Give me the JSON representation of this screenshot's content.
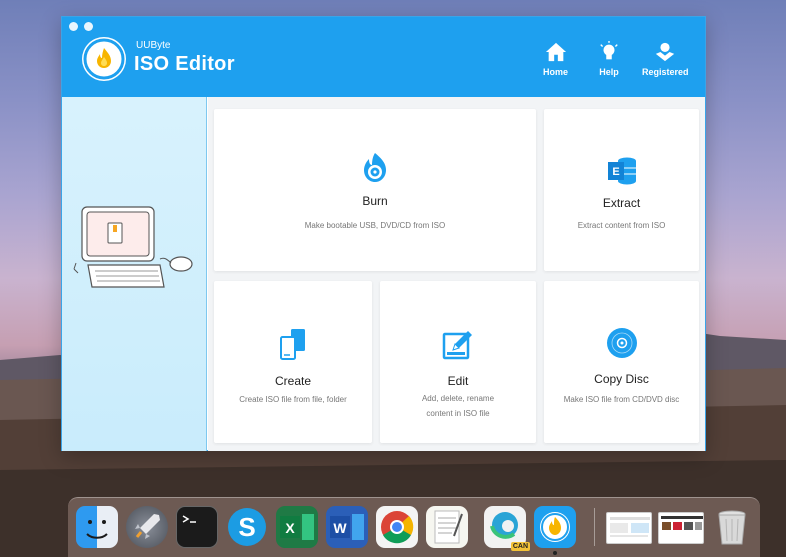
{
  "app": {
    "brand_small": "UUByte",
    "brand_name": "ISO Editor"
  },
  "nav": {
    "home": "Home",
    "help": "Help",
    "registered": "Registered"
  },
  "cards": {
    "burn": {
      "title": "Burn",
      "desc": "Make bootable USB, DVD/CD from ISO"
    },
    "extract": {
      "title": "Extract",
      "desc": "Extract content from ISO"
    },
    "create": {
      "title": "Create",
      "desc": "Create ISO file from file, folder"
    },
    "edit": {
      "title": "Edit",
      "desc": "Add, delete, rename content in ISO file"
    },
    "copy": {
      "title": "Copy Disc",
      "desc": "Make ISO file from CD/DVD disc"
    }
  },
  "dock": {
    "can_badge": "CAN",
    "apps": [
      "finder",
      "launchpad",
      "terminal",
      "skype",
      "excel",
      "word",
      "chrome",
      "textedit",
      "edge-canary",
      "uubyte-iso-editor"
    ]
  },
  "colors": {
    "accent": "#1ea0ef",
    "icon_blue": "#1ea0ef",
    "sidebar": "#d8f2fd"
  }
}
